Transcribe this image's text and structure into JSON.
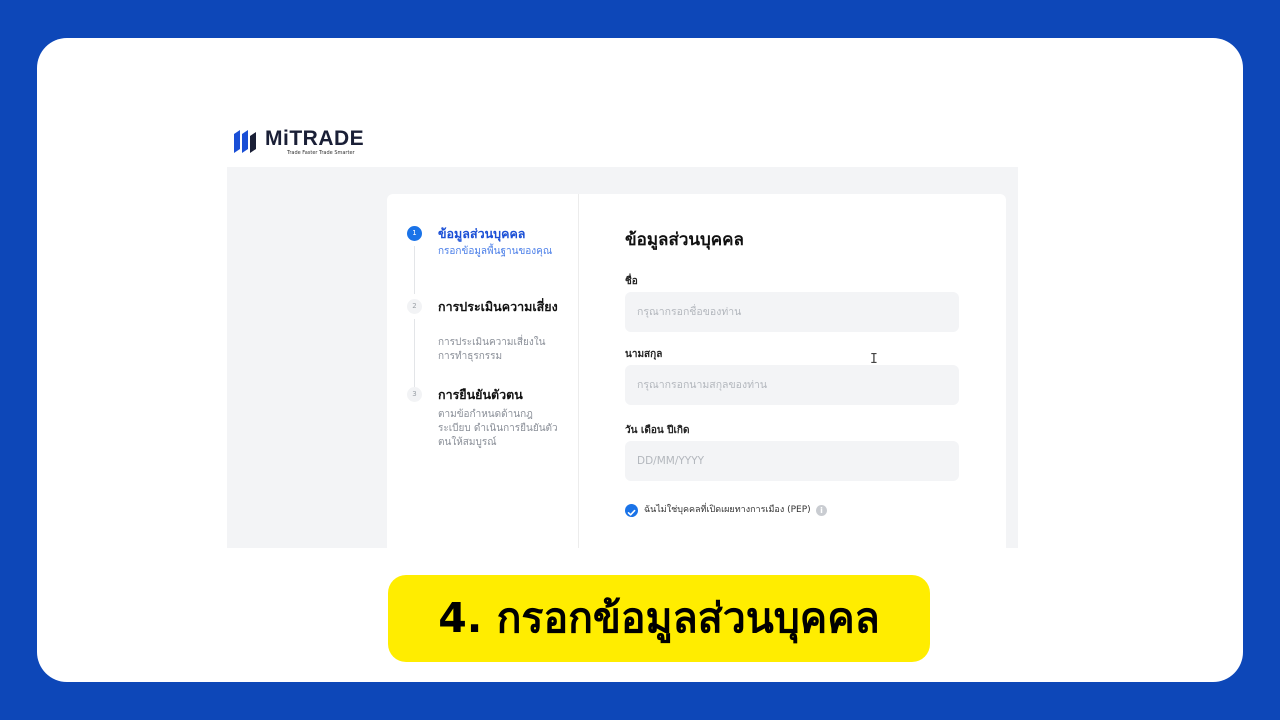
{
  "brand": {
    "name": "MiTRADE",
    "tagline": "Trade Faster Trade Smarter",
    "color": "#1a4fd6"
  },
  "stepper": [
    {
      "number": "1",
      "title": "ข้อมูลส่วนบุคคล",
      "description": "กรอกข้อมูลพื้นฐานของคุณ",
      "active": true
    },
    {
      "number": "2",
      "title": "การประเมินความเสี่ยง",
      "description": "การประเมินความเสี่ยงในการทำธุรกรรม",
      "active": false
    },
    {
      "number": "3",
      "title": "การยืนยันตัวตน",
      "description": "ตามข้อกำหนดด้านกฎระเบียบ ดำเนินการยืนยันตัวตนให้สมบูรณ์",
      "active": false
    }
  ],
  "form": {
    "title": "ข้อมูลส่วนบุคคล",
    "first_name": {
      "label": "ชื่อ",
      "placeholder": "กรุณากรอกชื่อของท่าน",
      "value": ""
    },
    "last_name": {
      "label": "นามสกุล",
      "placeholder": "กรุณากรอกนามสกุลของท่าน",
      "value": ""
    },
    "birth_date": {
      "label": "วัน เดือน ปีเกิด",
      "placeholder": "DD/MM/YYYY",
      "value": ""
    },
    "pep_checkbox": {
      "label": "ฉันไม่ใช่บุคคลที่เปิดเผยทางการเมือง (PEP)",
      "checked": true
    }
  },
  "caption": "4. กรอกข้อมูลส่วนบุคคล",
  "colors": {
    "background": "#0d47b8",
    "caption_bg": "#ffed00",
    "accent": "#1a73e8"
  }
}
